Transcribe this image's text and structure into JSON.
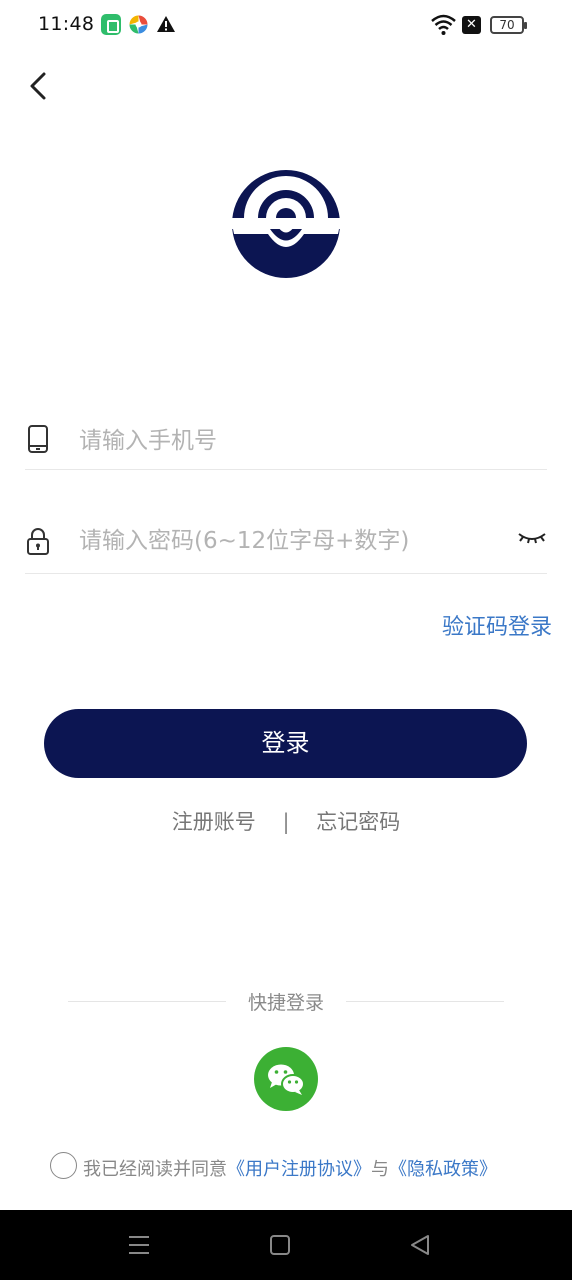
{
  "status_bar": {
    "time": "11:48",
    "battery": "70",
    "icons": [
      "app-notification-icon",
      "colorful-app-icon",
      "warning-icon",
      "wifi-icon",
      "no-sim-icon",
      "battery-icon"
    ]
  },
  "header": {
    "back_icon": "chevron-left-icon"
  },
  "logo": {
    "icon": "brand-logo",
    "color": "#0c1552"
  },
  "form": {
    "phone_placeholder": "请输入手机号",
    "phone_value": "",
    "password_placeholder": "请输入密码(6~12位字母+数字)",
    "password_value": "",
    "phone_icon": "phone-icon",
    "lock_icon": "lock-icon",
    "eye_icon": "eye-closed-icon",
    "sms_login_label": "验证码登录",
    "login_label": "登录"
  },
  "links": {
    "register": "注册账号",
    "divider": "|",
    "forgot": "忘记密码"
  },
  "quick_login": {
    "title": "快捷登录",
    "wechat_icon": "wechat-icon"
  },
  "agreement": {
    "prefix": "我已经阅读并同意",
    "user_agreement": "《用户注册协议》",
    "conjunction": "与",
    "privacy_policy": "《隐私政策》"
  },
  "colors": {
    "primary": "#0c1552",
    "link": "#3b78c7",
    "wechat": "#3cb034"
  }
}
